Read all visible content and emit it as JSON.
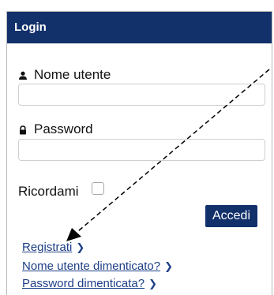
{
  "login": {
    "title": "Login",
    "username": {
      "label": "Nome utente",
      "value": ""
    },
    "password": {
      "label": "Password",
      "value": ""
    },
    "remember_me": {
      "label": "Ricordami",
      "checked": false
    },
    "submit_label": "Accedi",
    "links": [
      {
        "label": "Registrati",
        "chevron": "chevron-right-icon"
      },
      {
        "label": "Nome utente dimenticato?",
        "chevron": "chevron-right-icon"
      },
      {
        "label": "Password dimenticata?",
        "chevron": "chevron-right-icon"
      }
    ]
  },
  "icons": {
    "username": "user-icon",
    "password": "lock-icon"
  },
  "colors": {
    "header_bg": "#12306a",
    "button_bg": "#12306a",
    "link": "#1d3f86"
  }
}
